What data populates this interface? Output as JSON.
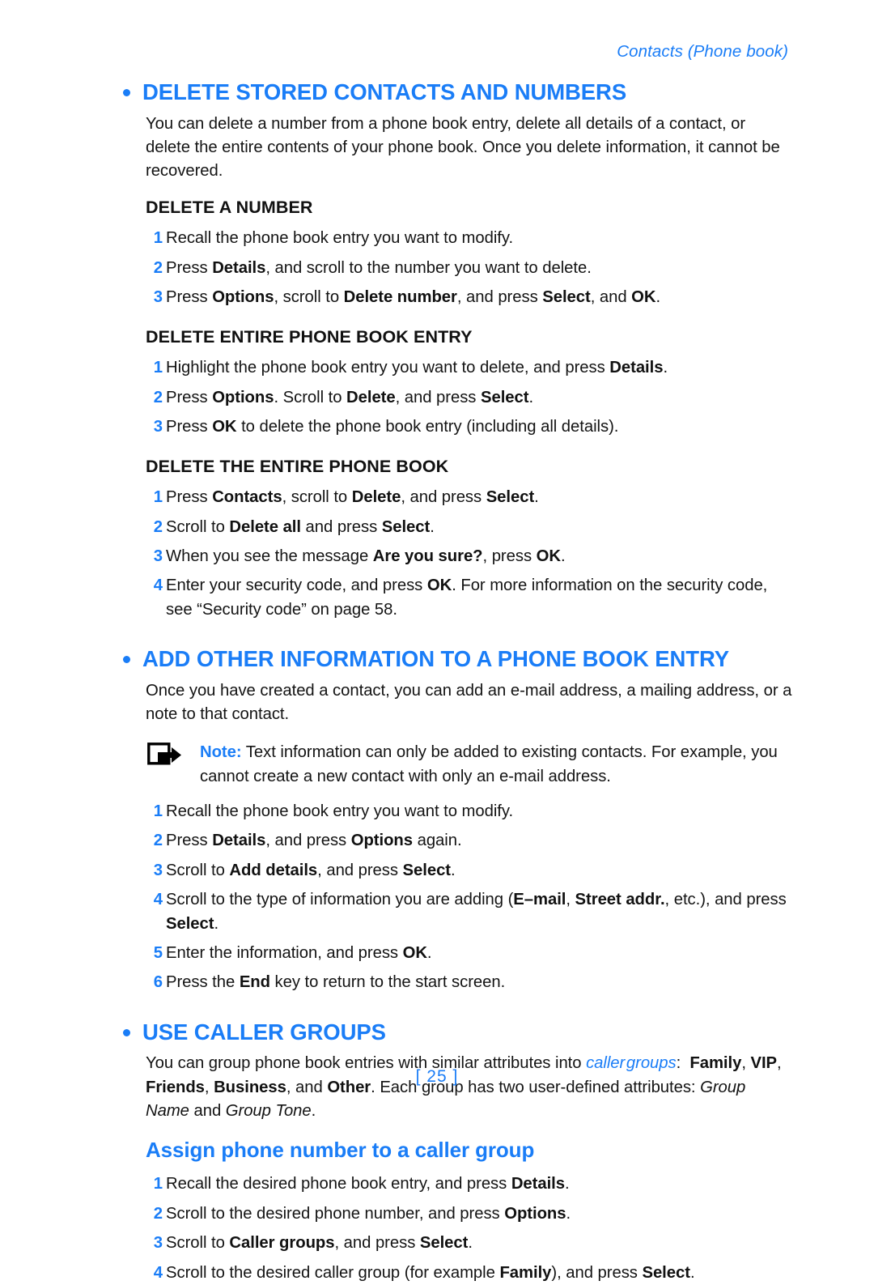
{
  "header": {
    "running_head": "Contacts (Phone book)"
  },
  "footer": {
    "page_number": "[ 25 ]"
  },
  "colors": {
    "accent_blue": "#1a7df7",
    "body_black": "#141414"
  },
  "sections": [
    {
      "id": "delete-stored-contacts-and-numbers",
      "heading": "DELETE STORED CONTACTS AND NUMBERS",
      "intro": "You can delete a number from a phone book entry, delete all details of a contact, or delete the entire contents of your phone book. Once you delete information, it cannot be recovered.",
      "subsections": [
        {
          "id": "delete-a-number",
          "heading": "DELETE A NUMBER",
          "steps": [
            {
              "num": "1",
              "text": "Recall the phone book entry you want to modify."
            },
            {
              "num": "2",
              "text": "Press Details, and scroll to the number you want to delete."
            },
            {
              "num": "3",
              "text": "Press Options, scroll to Delete number, and press Select, and OK."
            }
          ]
        },
        {
          "id": "delete-entire-phone-book-entry",
          "heading": "DELETE ENTIRE PHONE BOOK ENTRY",
          "steps": [
            {
              "num": "1",
              "text": "Highlight the phone book entry you want to delete, and press Details."
            },
            {
              "num": "2",
              "text": "Press Options. Scroll to Delete, and press Select."
            },
            {
              "num": "3",
              "text": "Press OK to delete the phone book entry (including all details)."
            }
          ]
        },
        {
          "id": "delete-the-entire-phone-book",
          "heading": "DELETE THE ENTIRE PHONE BOOK",
          "steps": [
            {
              "num": "1",
              "text": "Press Contacts, scroll to Delete, and press Select."
            },
            {
              "num": "2",
              "text": "Scroll to Delete all and press Select."
            },
            {
              "num": "3",
              "text": "When you see the message Are you sure?, press OK."
            },
            {
              "num": "4",
              "text": "Enter your security code, and press OK. For more information on the security code, see “Security code” on page 58."
            }
          ]
        }
      ]
    },
    {
      "id": "add-other-information-to-a-phone-book-entry",
      "heading": "ADD OTHER INFORMATION TO A PHONE BOOK ENTRY",
      "intro": "Once you have created a contact, you can add an e-mail address, a mailing address, or a note to that contact.",
      "note": {
        "icon": "note-arrow-icon",
        "label": "Note:",
        "text": "Text information can only be added to existing contacts. For example, you cannot create a new contact with only an e-mail address."
      },
      "steps": [
        {
          "num": "1",
          "text": "Recall the phone book entry you want to modify."
        },
        {
          "num": "2",
          "text": "Press Details, and press Options again."
        },
        {
          "num": "3",
          "text": "Scroll to Add details, and press Select."
        },
        {
          "num": "4",
          "text": "Scroll to the type of information you are adding (E–mail, Street addr., etc.), and press Select."
        },
        {
          "num": "5",
          "text": "Enter the information, and press OK."
        },
        {
          "num": "6",
          "text": "Press the End key to return to the start screen."
        }
      ]
    },
    {
      "id": "use-caller-groups",
      "heading": "USE CALLER GROUPS",
      "intro": "You can group phone book entries with similar attributes into caller groups: Family, VIP, Friends, Business, and Other. Each group has two user-defined attributes: Group Name and Group Tone.",
      "subheading": "Assign phone number to a caller group",
      "steps": [
        {
          "num": "1",
          "text": "Recall the desired phone book entry, and press Details."
        },
        {
          "num": "2",
          "text": "Scroll to the desired phone number, and press Options."
        },
        {
          "num": "3",
          "text": "Scroll to Caller groups, and press Select."
        },
        {
          "num": "4",
          "text": "Scroll to the desired caller group (for example Family), and press Select."
        }
      ]
    }
  ]
}
